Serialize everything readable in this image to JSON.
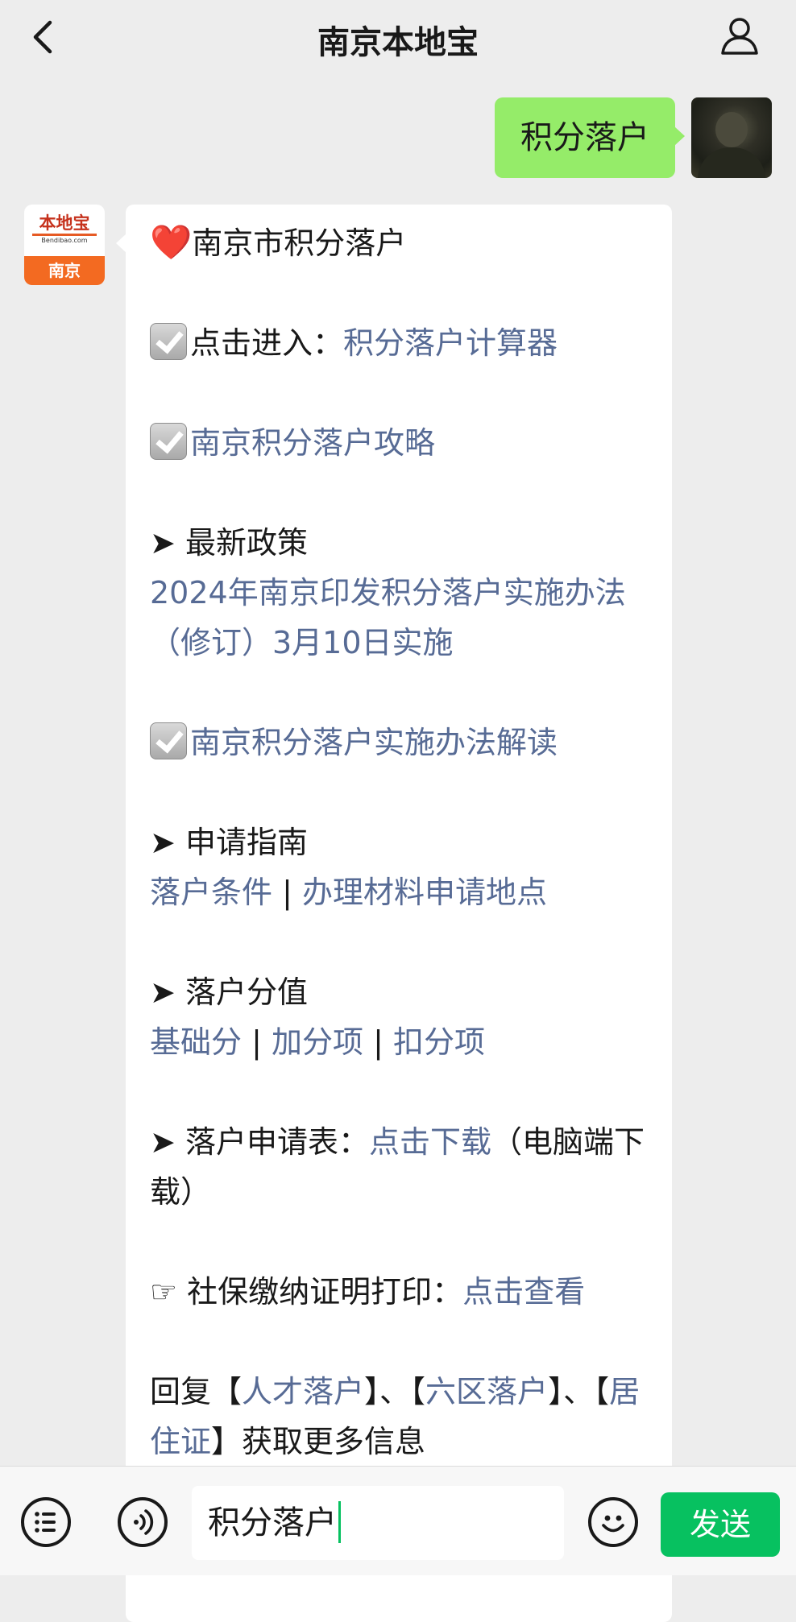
{
  "header": {
    "title": "南京本地宝",
    "back_icon": "chevron-left-icon",
    "profile_icon": "user-icon"
  },
  "outgoing": {
    "text": "积分落户"
  },
  "bot": {
    "avatar_brand": "本地宝",
    "avatar_domain": "Bendibao.com",
    "avatar_city": "南京"
  },
  "message": {
    "heading_icon": "❤️",
    "heading": "南京市积分落户",
    "enter_label": "点击进入：",
    "enter_link": "积分落户计算器",
    "guide_link": "南京积分落户攻略",
    "arrow": "➤",
    "policy_label": "最新政策",
    "policy_link": "2024年南京印发积分落户实施办法（修订）3月10日实施",
    "interpretation_link": "南京积分落户实施办法解读",
    "apply_label": "申请指南",
    "apply_link1": "落户条件",
    "separator": "|",
    "apply_link2": "办理材料申请地点",
    "score_label": "落户分值",
    "score_link1": "基础分",
    "score_link2": "加分项",
    "score_link3": "扣分项",
    "form_label": "落户申请表：",
    "form_link": "点击下载",
    "form_note": "（电脑端下载）",
    "pointer": "☞",
    "social_label": "社保缴纳证明打印：",
    "social_link": "点击查看",
    "reply_prefix": "回复【",
    "reply_link1": "人才落户",
    "reply_mid1": "】、【",
    "reply_link2": "六区落户",
    "reply_mid2": "】、【",
    "reply_link3": "居住证",
    "reply_suffix": "】获取更多信息"
  },
  "inputbar": {
    "value": "积分落户",
    "send_label": "发送",
    "menu_icon": "list-icon",
    "voice_icon": "voice-icon",
    "emoji_icon": "emoji-icon"
  },
  "colors": {
    "outgoing_bubble": "#95ec69",
    "link": "#576b95",
    "send_button": "#07c160"
  }
}
